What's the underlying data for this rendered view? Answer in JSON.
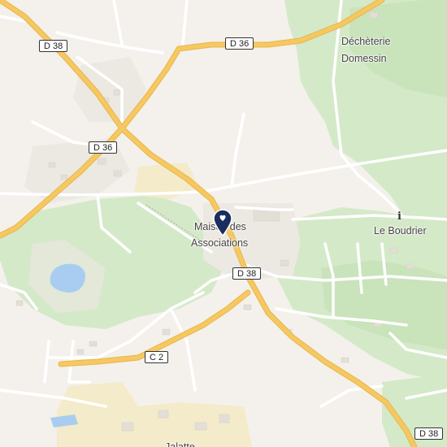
{
  "map": {
    "road_labels": {
      "d38_nw": "D 38",
      "d36_n": "D 36",
      "d36_w": "D 36",
      "d38_c": "D 38",
      "c2": "C 2",
      "d38_se": "D 38"
    },
    "place_labels": {
      "decheterie_line1": "Déchèterie",
      "decheterie_line2": "Domessin",
      "le_boudrier": "Le Boudrier",
      "maison_line1": "Maison des",
      "maison_line2": "Associations",
      "bottom_partial": "Jalatte"
    },
    "icons": {
      "info_poi": "i",
      "marker": "map-pin-icon"
    },
    "colors": {
      "background": "#f4f1ec",
      "forest": "#d4e9c8",
      "forest_dark": "#c9e3bb",
      "major_road": "#f6c862",
      "major_road_casing": "#e8b54a",
      "minor_road": "#ffffff",
      "water": "#a8cdf0",
      "industrial": "#f3ebc9",
      "marker": "#1b2d5e"
    }
  }
}
